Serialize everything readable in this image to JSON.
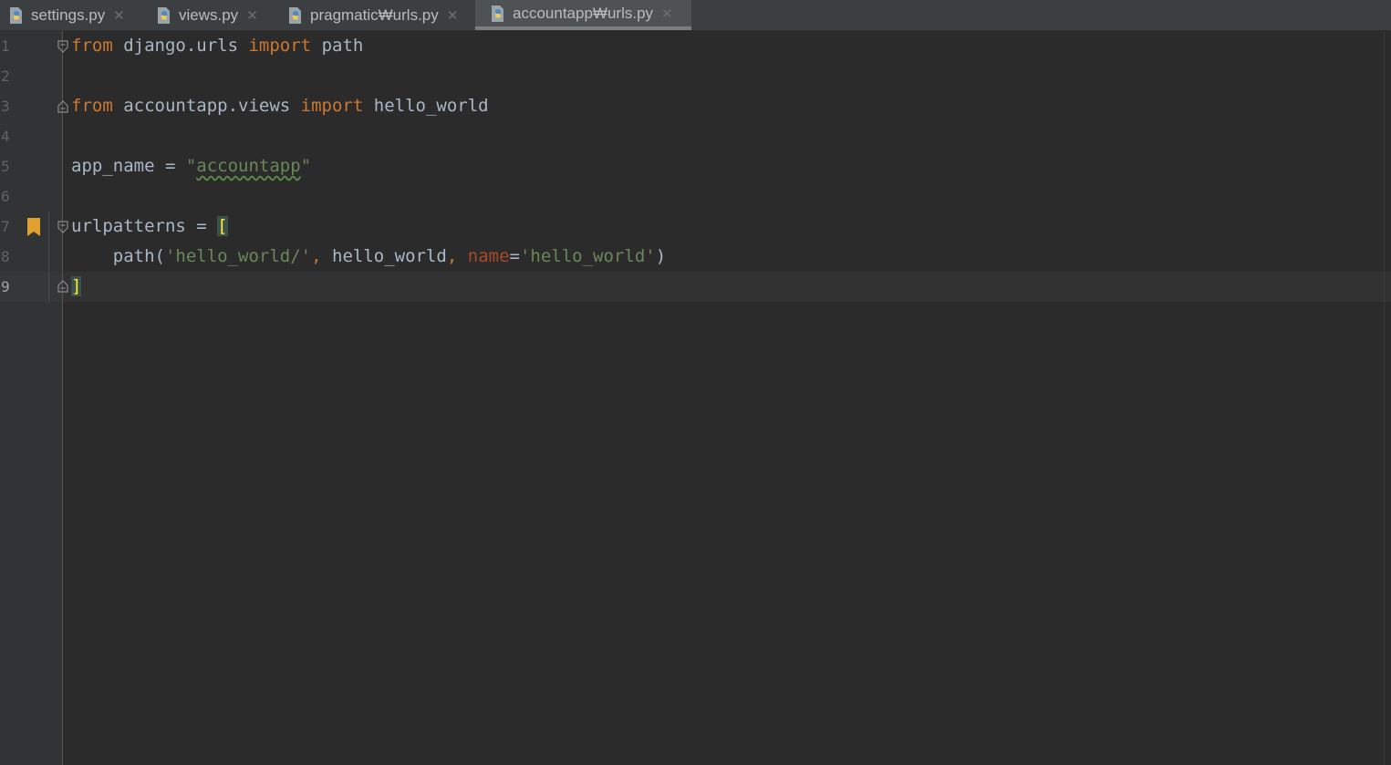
{
  "tabs": [
    {
      "label": "settings.py",
      "icon": "python-file-icon",
      "active": false
    },
    {
      "label": "views.py",
      "icon": "python-file-icon",
      "active": false
    },
    {
      "label": "pragmatic₩urls.py",
      "icon": "python-file-icon",
      "active": false
    },
    {
      "label": "accountapp₩urls.py",
      "icon": "python-file-icon",
      "active": true
    }
  ],
  "close_glyph": "✕",
  "line_numbers": [
    "1",
    "2",
    "3",
    "4",
    "5",
    "6",
    "7",
    "8",
    "9"
  ],
  "current_line": 9,
  "code": {
    "line1": {
      "kw1": "from",
      "mod": " django.urls ",
      "kw2": "import",
      "name": " path"
    },
    "line3": {
      "kw1": "from",
      "mod": " accountapp.views ",
      "kw2": "import",
      "name": " hello_world"
    },
    "line5": {
      "var": "app_name = ",
      "q1": "\"",
      "val": "accountapp",
      "q2": "\""
    },
    "line7": {
      "var": "urlpatterns = ",
      "bracket": "["
    },
    "line8": {
      "indent": "    ",
      "fn": "path(",
      "arg1": "'hello_world/'",
      "comma1": ",",
      "arg2": " hello_world",
      "comma2": ",",
      "sp": " ",
      "kwarg": "name",
      "eq": "=",
      "arg3": "'hello_world'",
      "close": ")"
    },
    "line9": {
      "bracket": "]"
    }
  },
  "colors": {
    "background": "#2b2b2b",
    "keyword": "#cc7832",
    "string": "#6a8759",
    "parameter": "#aa4926",
    "text": "#a9b7c6",
    "bookmark": "#e0a030"
  }
}
